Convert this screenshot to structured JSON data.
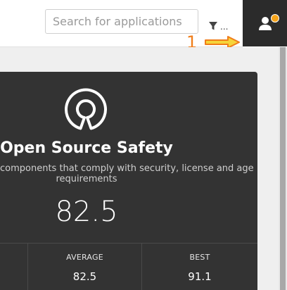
{
  "search": {
    "placeholder": "Search for applications"
  },
  "filter": {
    "more_label": "..."
  },
  "callout": {
    "number": "1"
  },
  "card": {
    "title": "Open Source Safety",
    "description_line1": "components that comply with security, license and age",
    "description_line2": "requirements",
    "score": "82.5",
    "stats": [
      {
        "label": "",
        "value": ""
      },
      {
        "label": "AVERAGE",
        "value": "82.5"
      },
      {
        "label": "BEST",
        "value": "91.1"
      }
    ]
  },
  "colors": {
    "accent_orange": "#f07d1a",
    "badge": "#f5a31a",
    "card_bg": "#333333",
    "user_tile_bg": "#2b2b2b"
  }
}
